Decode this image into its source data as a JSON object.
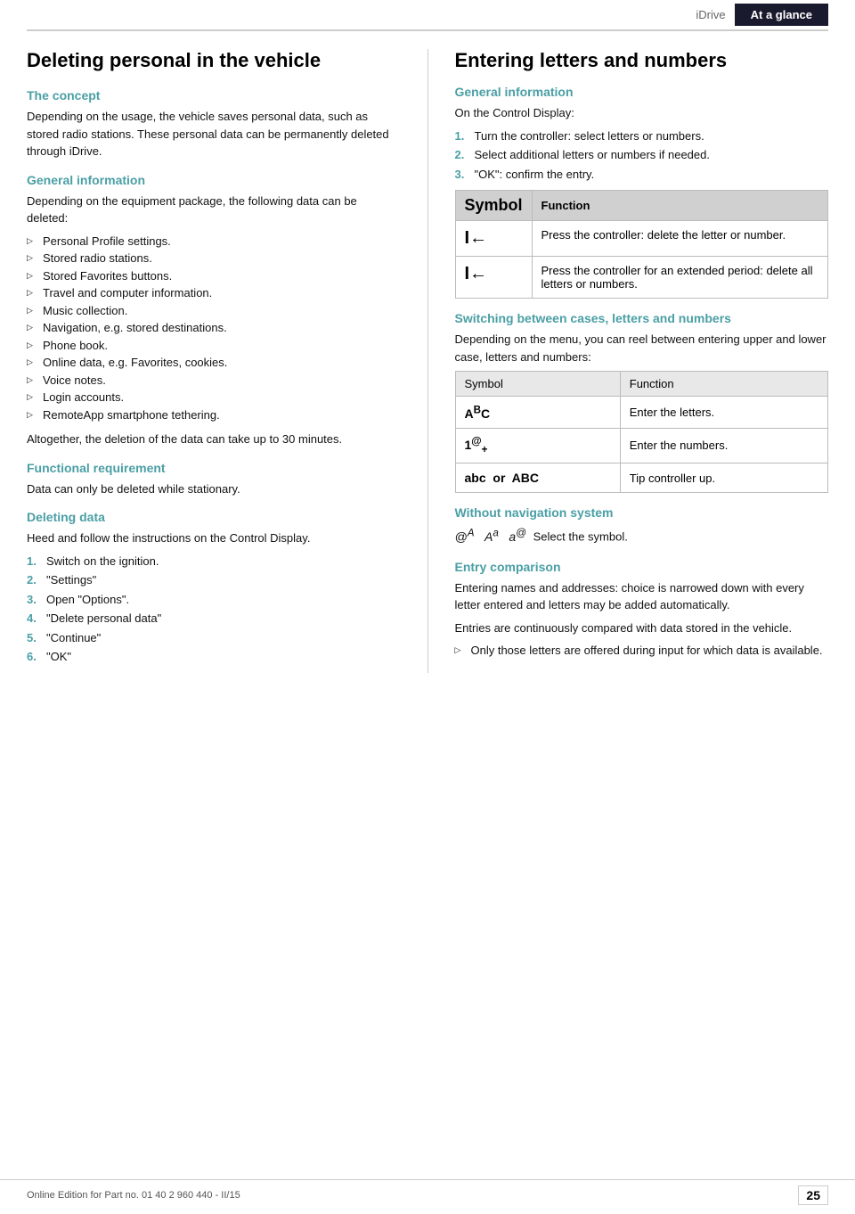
{
  "header": {
    "idrive_label": "iDrive",
    "tab_label": "At a glance"
  },
  "left_col": {
    "page_title": "Deleting personal in the vehicle",
    "sections": [
      {
        "id": "the-concept",
        "heading": "The concept",
        "body": "Depending on the usage, the vehicle saves personal data, such as stored radio stations. These personal data can be permanently deleted through iDrive."
      },
      {
        "id": "general-information",
        "heading": "General information",
        "intro": "Depending on the equipment package, the following data can be deleted:",
        "bullets": [
          "Personal Profile settings.",
          "Stored radio stations.",
          "Stored Favorites buttons.",
          "Travel and computer information.",
          "Music collection.",
          "Navigation, e.g. stored destinations.",
          "Phone book.",
          "Online data, e.g. Favorites, cookies.",
          "Voice notes.",
          "Login accounts.",
          "RemoteApp smartphone tethering."
        ],
        "footer": "Altogether, the deletion of the data can take up to 30 minutes."
      },
      {
        "id": "functional-requirement",
        "heading": "Functional requirement",
        "body": "Data can only be deleted while stationary."
      },
      {
        "id": "deleting-data",
        "heading": "Deleting data",
        "body": "Heed and follow the instructions on the Control Display.",
        "steps": [
          "Switch on the ignition.",
          "\"Settings\"",
          "Open \"Options\".",
          "\"Delete personal data\"",
          "\"Continue\"",
          "\"OK\""
        ]
      }
    ]
  },
  "right_col": {
    "page_title": "Entering letters and numbers",
    "sections": [
      {
        "id": "general-information-right",
        "heading": "General information",
        "intro": "On the Control Display:",
        "steps": [
          "Turn the controller: select letters or numbers.",
          "Select additional letters or numbers if needed.",
          "\"OK\": confirm the entry."
        ],
        "table": {
          "headers": [
            "Symbol",
            "Function"
          ],
          "rows": [
            {
              "symbol": "I←",
              "function": "Press the controller: delete the letter or number."
            },
            {
              "symbol": "I←",
              "function": "Press the controller for an extended period: delete all letters or numbers."
            }
          ]
        }
      },
      {
        "id": "switching-between-cases",
        "heading": "Switching between cases, letters and numbers",
        "body": "Depending on the menu, you can reel between entering upper and lower case, letters and numbers:",
        "table": {
          "headers": [
            "Symbol",
            "Function"
          ],
          "rows": [
            {
              "symbol": "AᴬC",
              "function": "Enter the letters."
            },
            {
              "symbol": "1®₊",
              "function": "Enter the numbers."
            },
            {
              "symbol": "abc  or  ABC",
              "function": "Tip controller up."
            }
          ]
        }
      },
      {
        "id": "without-navigation",
        "heading": "Without navigation system",
        "body": "@ᴬ  Aᵃ  aᵇ  Select the symbol."
      },
      {
        "id": "entry-comparison",
        "heading": "Entry comparison",
        "paragraphs": [
          "Entering names and addresses: choice is narrowed down with every letter entered and letters may be added automatically.",
          "Entries are continuously compared with data stored in the vehicle."
        ],
        "bullet": "Only those letters are offered during input for which data is available."
      }
    ]
  },
  "footer": {
    "text": "Online Edition for Part no. 01 40 2 960 440 - II/15",
    "page": "25"
  }
}
